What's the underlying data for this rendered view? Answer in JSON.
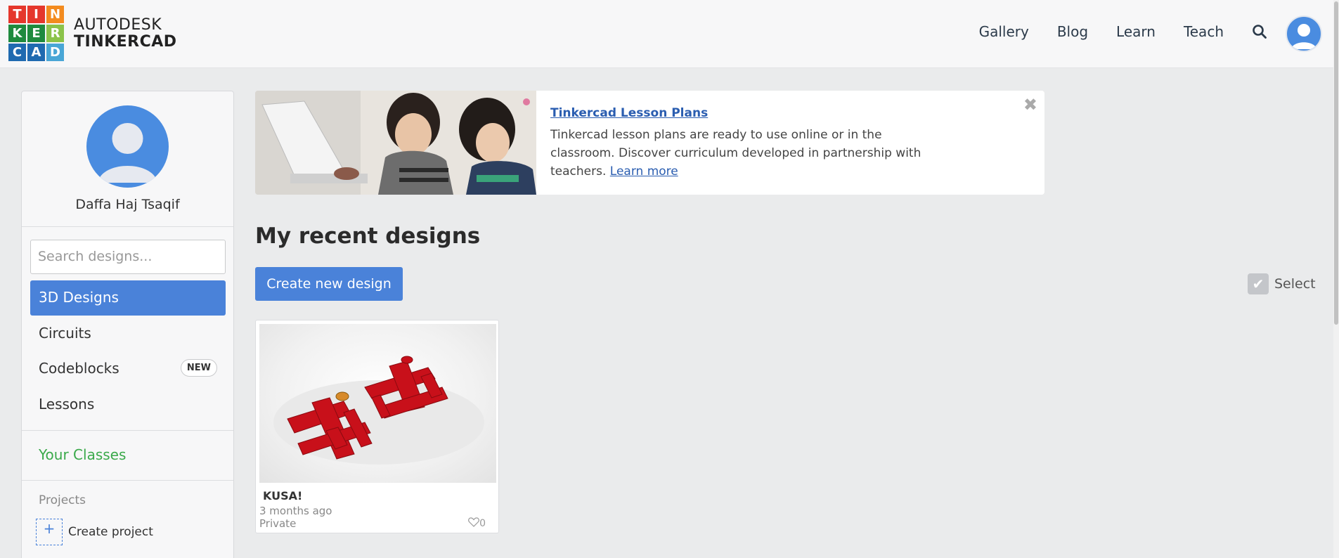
{
  "header": {
    "logo_letters": [
      "T",
      "I",
      "N",
      "K",
      "E",
      "R",
      "C",
      "A",
      "D"
    ],
    "logo_colors": [
      "#e5372c",
      "#e5372c",
      "#f38b1f",
      "#1f8a3e",
      "#1f8a3e",
      "#8bc34a",
      "#1f6ab0",
      "#1f6ab0",
      "#49a6d6"
    ],
    "brand_line1": "AUTODESK",
    "brand_line2": "TINKERCAD",
    "nav": [
      "Gallery",
      "Blog",
      "Learn",
      "Teach"
    ],
    "search_icon": "search-icon",
    "avatar_icon": "user-avatar-icon"
  },
  "sidebar": {
    "user_name": "Daffa Haj Tsaqif",
    "search_placeholder": "Search designs...",
    "items": [
      {
        "label": "3D Designs"
      },
      {
        "label": "Circuits"
      },
      {
        "label": "Codeblocks",
        "badge": "NEW"
      },
      {
        "label": "Lessons"
      }
    ],
    "classes_label": "Your Classes",
    "projects_label": "Projects",
    "create_project_label": "Create project",
    "create_project_icon": "+"
  },
  "banner": {
    "title": "Tinkercad Lesson Plans",
    "body": "Tinkercad lesson plans are ready to use online or in the classroom. Discover curriculum developed in partnership with teachers.",
    "link": "Learn more",
    "close_icon": "✖"
  },
  "main": {
    "title": "My recent designs",
    "create_button": "Create new design",
    "select_label": "Select",
    "select_icon": "✔",
    "designs": [
      {
        "title": "KUSA!",
        "time": "3 months ago",
        "visibility": "Private",
        "likes": "0"
      }
    ]
  },
  "colors": {
    "accent": "#4a82d9",
    "classes_green": "#3aa94a",
    "link_blue": "#2a5db0"
  }
}
